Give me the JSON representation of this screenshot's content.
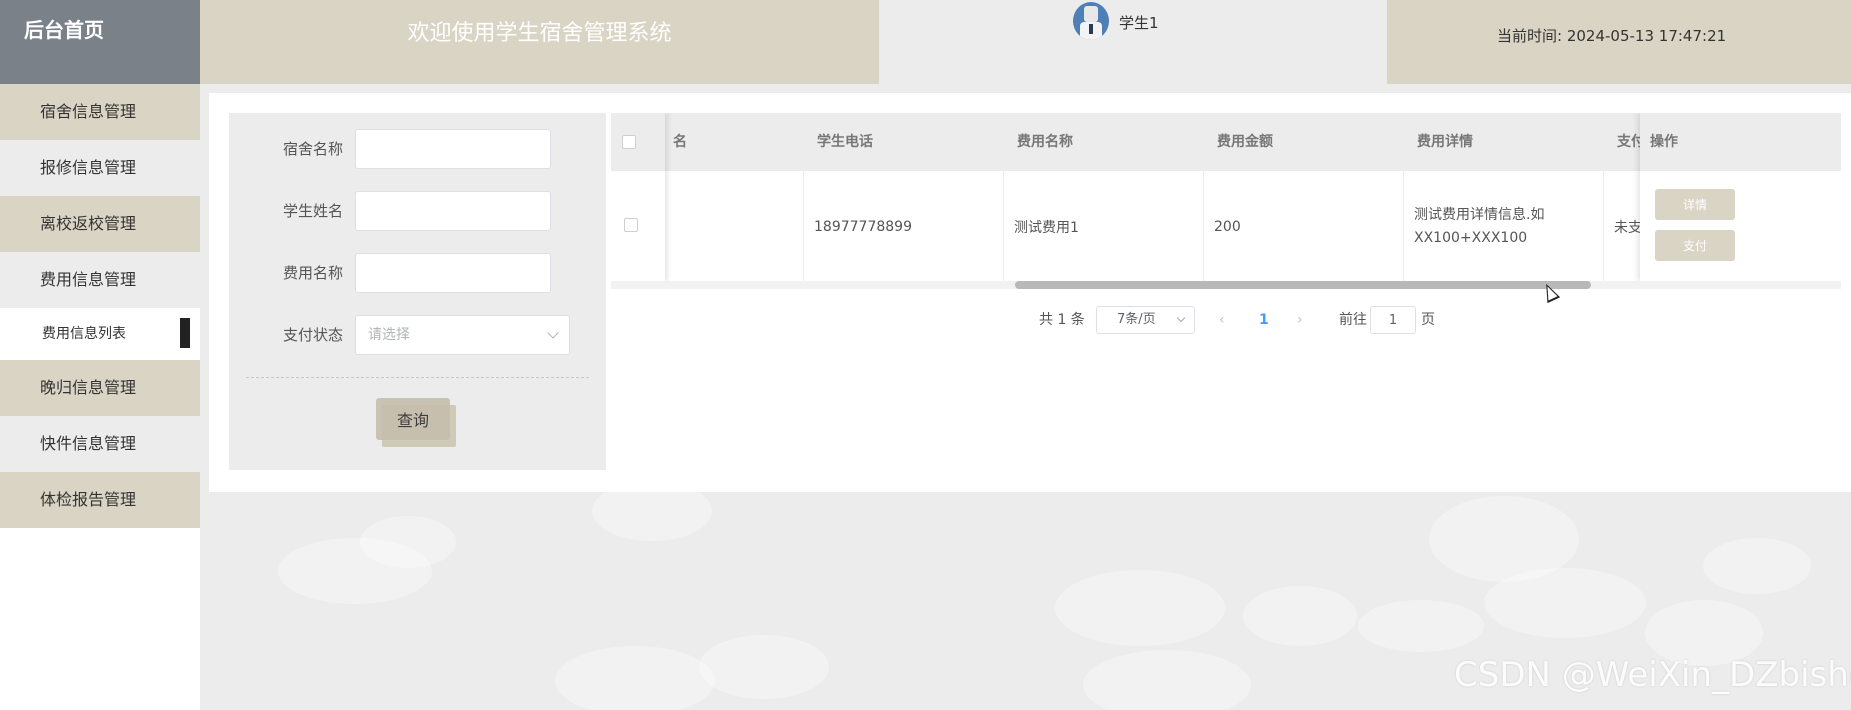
{
  "header": {
    "logo": "后台首页",
    "title": "欢迎使用学生宿舍管理系统",
    "username": "学生1",
    "time_label": "当前时间:",
    "time_value": "2024-05-13 17:47:21"
  },
  "sidebar": {
    "items": [
      {
        "label": "宿舍信息管理"
      },
      {
        "label": "报修信息管理"
      },
      {
        "label": "离校返校管理"
      },
      {
        "label": "费用信息管理"
      },
      {
        "label": "费用信息列表"
      },
      {
        "label": "晚归信息管理"
      },
      {
        "label": "快件信息管理"
      },
      {
        "label": "体检报告管理"
      }
    ]
  },
  "search": {
    "dorm_label": "宿舍名称",
    "dorm_value": "",
    "student_label": "学生姓名",
    "student_value": "",
    "fee_label": "费用名称",
    "fee_value": "",
    "pay_label": "支付状态",
    "pay_placeholder": "请选择",
    "query_button": "查询"
  },
  "table": {
    "columns": [
      "名",
      "学生电话",
      "费用名称",
      "费用金额",
      "费用详情",
      "支付",
      "操作"
    ],
    "rows": [
      {
        "phone": "18977778899",
        "fee_name": "测试费用1",
        "amount": "200",
        "detail": "测试费用详情信息.如XX100+XXX100",
        "pay_status": "未支",
        "detail_btn": "详情",
        "pay_btn": "支付"
      }
    ]
  },
  "pagination": {
    "total": "共 1 条",
    "page_size": "7条/页",
    "current_page": "1",
    "goto_label": "前往",
    "goto_value": "1",
    "page_suffix": "页"
  },
  "watermark": "CSDN @WeiXin_DZbishe",
  "colors": {
    "tan": "#d9d4c4",
    "logo_bg": "#7b8189",
    "active_page": "#409eff"
  }
}
